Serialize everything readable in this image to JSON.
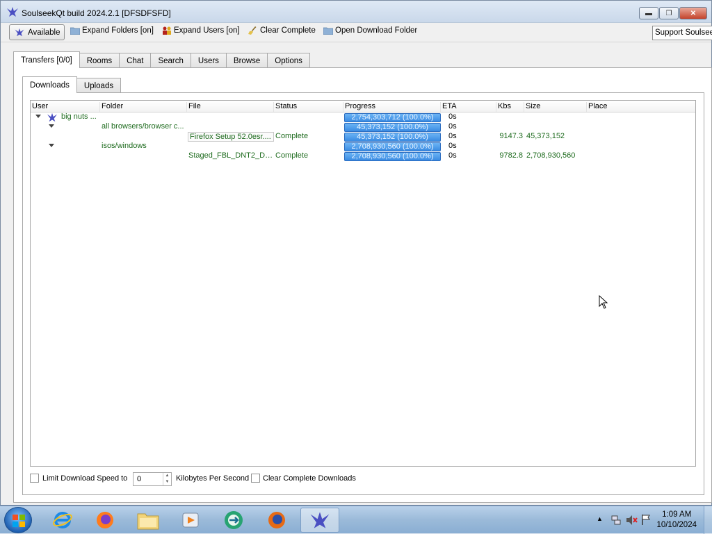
{
  "window": {
    "title": "SoulseekQt build 2024.2.1 [DFSDFSFD]",
    "minimize": "▬",
    "maximize": "❐",
    "close": "✕"
  },
  "toolbar": {
    "available": "Available",
    "expand_folders": "Expand Folders [on]",
    "expand_users": "Expand Users [on]",
    "clear_complete": "Clear Complete",
    "open_download_folder": "Open Download Folder",
    "support": "Support Soulseek"
  },
  "main_tabs": [
    "Transfers [0/0]",
    "Rooms",
    "Chat",
    "Search",
    "Users",
    "Browse",
    "Options"
  ],
  "sub_tabs": [
    "Downloads",
    "Uploads"
  ],
  "columns": [
    "User",
    "Folder",
    "File",
    "Status",
    "Progress",
    "ETA",
    "Kbs",
    "Size",
    "Place"
  ],
  "rows": [
    {
      "user": "big nuts ...",
      "folder": "",
      "file": "",
      "status": "",
      "progress": "2,754,303,712 (100.0%)",
      "eta": "0s",
      "kbs": "",
      "size": "",
      "place": ""
    },
    {
      "user": "",
      "folder": "all browsers/browser c...",
      "file": "",
      "status": "",
      "progress": "45,373,152 (100.0%)",
      "eta": "0s",
      "kbs": "",
      "size": "",
      "place": ""
    },
    {
      "user": "",
      "folder": "",
      "file": "Firefox Setup 52.0esr....",
      "status": "Complete",
      "progress": "45,373,152 (100.0%)",
      "eta": "0s",
      "kbs": "9147.3",
      "size": "45,373,152",
      "place": ""
    },
    {
      "user": "",
      "folder": "isos/windows",
      "file": "",
      "status": "",
      "progress": "2,708,930,560 (100.0%)",
      "eta": "0s",
      "kbs": "",
      "size": "",
      "place": ""
    },
    {
      "user": "",
      "folder": "",
      "file": "Staged_FBL_DNT2_DC...",
      "status": "Complete",
      "progress": "2,708,930,560 (100.0%)",
      "eta": "0s",
      "kbs": "9782.8",
      "size": "2,708,930,560",
      "place": ""
    }
  ],
  "bottom": {
    "limit_speed_label": "Limit Download Speed to",
    "speed_value": "0",
    "units_label": "Kilobytes Per Second",
    "clear_complete_label": "Clear Complete Downloads"
  },
  "taskbar": {
    "apps": [
      "internet-explorer",
      "firefox",
      "file-explorer",
      "media-player",
      "teamviewer",
      "firefox",
      "soulseekqt"
    ],
    "time": "1:09 AM",
    "date": "10/10/2024"
  }
}
